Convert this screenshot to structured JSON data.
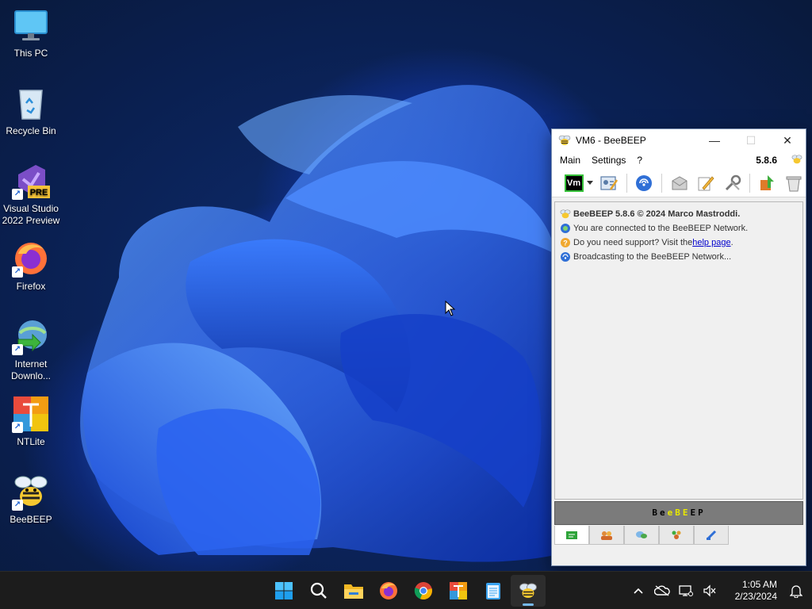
{
  "desktop": {
    "icons": [
      {
        "label": "This PC",
        "icon": "monitor-icon"
      },
      {
        "label": "Recycle Bin",
        "icon": "recycle-bin-icon"
      },
      {
        "label": "Visual Studio 2022 Preview",
        "icon": "visual-studio-icon",
        "badge": "PRE"
      },
      {
        "label": "Firefox",
        "icon": "firefox-icon"
      },
      {
        "label": "Internet Downlo...",
        "icon": "internet-download-manager-icon"
      },
      {
        "label": "NTLite",
        "icon": "ntlite-icon"
      },
      {
        "label": "BeeBEEP",
        "icon": "bee-icon"
      }
    ]
  },
  "window": {
    "title": "VM6 - BeeBEEP",
    "controls": {
      "minimize": "—",
      "maximize": "☐",
      "close": "✕"
    },
    "menu": [
      "Main",
      "Settings",
      "?"
    ],
    "version": "5.8.6",
    "toolbar": {
      "vm_badge": "Vm",
      "buttons": [
        "edit-profile-icon",
        "network-icon",
        "mail-icon",
        "write-icon",
        "tools-icon",
        "plugin-icon",
        "trash-icon"
      ]
    },
    "chat": {
      "header": "BeeBEEP 5.8.6 © 2024 Marco Mastroddi.",
      "connected": "You are connected to the BeeBEEP Network.",
      "support_prefix": "Do you need support? Visit the ",
      "support_link": "help page",
      "support_suffix": ".",
      "broadcasting": "Broadcasting to the BeeBEEP Network..."
    },
    "brand": {
      "letters": [
        "B",
        "e",
        "e",
        "B",
        "E",
        "E",
        "P"
      ],
      "colors": [
        "#000000",
        "#000000",
        "#e8e800",
        "#e8e800",
        "#e8e800",
        "#000000",
        "#000000"
      ]
    },
    "tabs": [
      "chat-tab-icon",
      "users-tab-icon",
      "groups-tab-icon",
      "group-chat-tab-icon",
      "files-tab-icon"
    ]
  },
  "taskbar": {
    "apps": [
      "windows-start-icon",
      "search-icon",
      "file-explorer-icon",
      "firefox-icon",
      "chrome-icon",
      "ntlite-icon",
      "notepad-icon",
      "beebeep-icon"
    ],
    "running_app": "beebeep-icon",
    "tray": [
      "chevron-up-icon",
      "cloud-offline-icon",
      "network-icon",
      "volume-muted-icon"
    ],
    "time": "1:05 AM",
    "date": "2/23/2024",
    "notification": "bell-icon"
  },
  "colors": {
    "accent": "#0078d4",
    "taskbar_bg": "#1c1c1c",
    "vm_badge_border": "#36c23a",
    "brand_bar": "#7b7b7b",
    "link": "#0000cc"
  }
}
